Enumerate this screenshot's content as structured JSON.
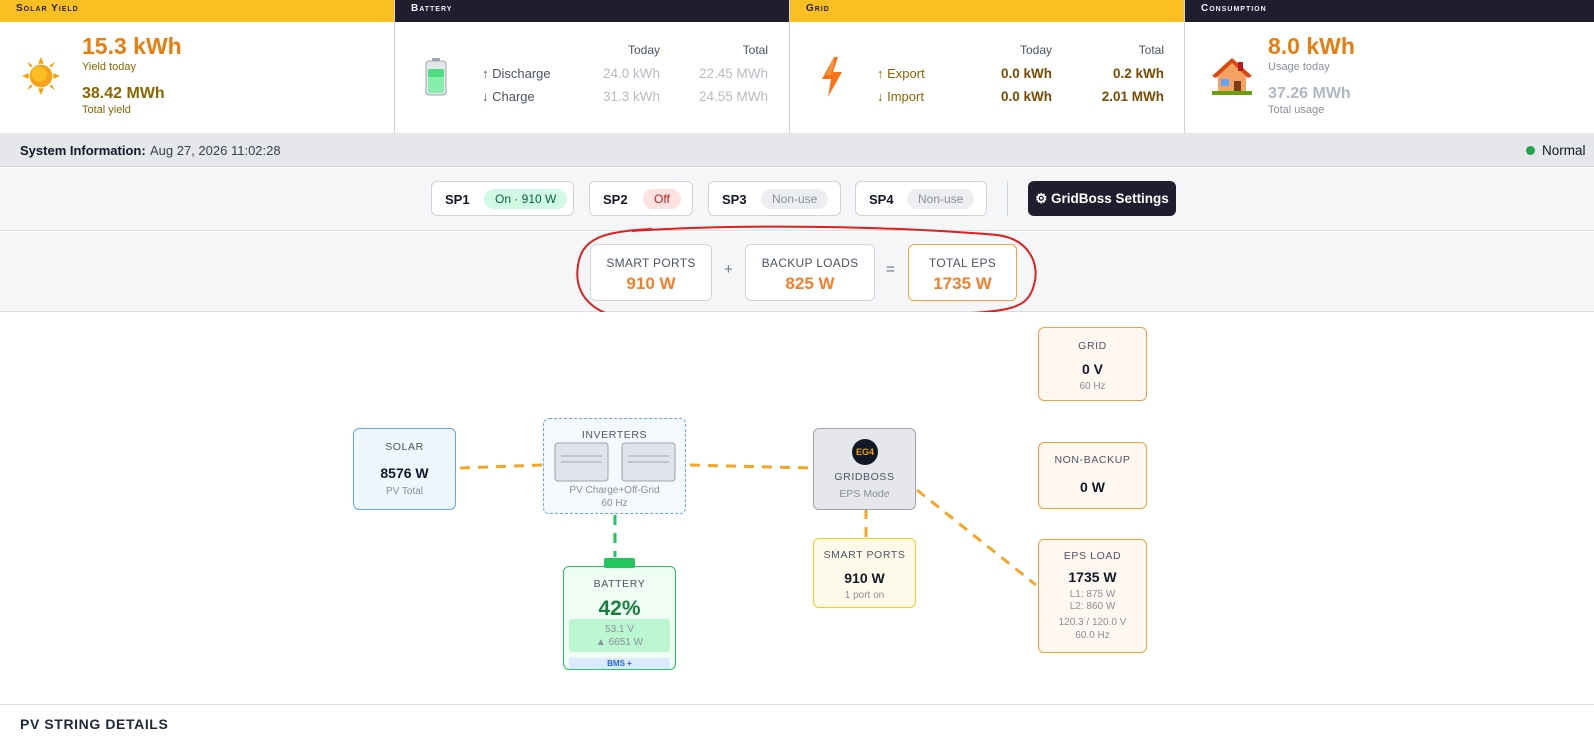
{
  "solar_card": {
    "header": "Solar Yield",
    "today_value": "15.3 kWh",
    "today_label": "Yield today",
    "total_value": "38.42 MWh",
    "total_label": "Total yield"
  },
  "battery_card": {
    "header": "Battery",
    "col_today": "Today",
    "col_total": "Total",
    "rows": [
      {
        "label": "↑ Discharge",
        "today": "24.0 kWh",
        "total": "22.45 MWh"
      },
      {
        "label": "↓ Charge",
        "today": "31.3 kWh",
        "total": "24.55 MWh"
      }
    ]
  },
  "grid_card": {
    "header": "Grid",
    "col_today": "Today",
    "col_total": "Total",
    "rows": [
      {
        "label": "↑ Export",
        "today": "0.0 kWh",
        "total": "0.2 kWh"
      },
      {
        "label": "↓ Import",
        "today": "0.0 kWh",
        "total": "2.01 MWh"
      }
    ]
  },
  "consumption_card": {
    "header": "Consumption",
    "today_value": "8.0 kWh",
    "today_label": "Usage today",
    "total_value": "37.26 MWh",
    "total_label": "Total usage"
  },
  "system_info": {
    "label": "System Information:",
    "timestamp": "Aug 27, 2026 11:02:28",
    "status": "Normal",
    "status_color": "#22a34a"
  },
  "smart_ports": [
    {
      "name": "SP1",
      "state": "On · 910 W"
    },
    {
      "name": "SP2",
      "state": "Off"
    },
    {
      "name": "SP3",
      "state": "Non-use"
    },
    {
      "name": "SP4",
      "state": "Non-use"
    }
  ],
  "gridboss_button": "⚙ GridBoss Settings",
  "eps_summary": {
    "smart_ports_label": "SMART PORTS",
    "smart_ports_value": "910 W",
    "plus": "+",
    "backup_label": "BACKUP LOADS",
    "backup_value": "825 W",
    "equals": "=",
    "total_label": "TOTAL EPS",
    "total_value": "1735 W"
  },
  "diagram": {
    "solar": {
      "title": "SOLAR",
      "value": "8576 W",
      "sub": "PV Total"
    },
    "inverters": {
      "title": "INVERTERS",
      "sub1": "PV Charge+Off-Grid",
      "sub2": "60 Hz"
    },
    "battery": {
      "title": "BATTERY",
      "soc": "42%",
      "voltage": "53.1 V",
      "power": "▲ 6651 W",
      "bms": "BMS +",
      "soc_fraction": 0.42
    },
    "gridboss": {
      "badge": "EG4",
      "title": "GRIDBOSS",
      "sub": "EPS Mode"
    },
    "smart_ports": {
      "title": "SMART PORTS",
      "value": "910 W",
      "sub": "1 port on"
    },
    "grid": {
      "title": "GRID",
      "value": "0 V",
      "sub": "60 Hz"
    },
    "non_backup": {
      "title": "NON-BACKUP",
      "value": "0 W"
    },
    "eps_load": {
      "title": "EPS LOAD",
      "value": "1735 W",
      "l1": "L1: 875 W",
      "l2": "L2: 860 W",
      "volts": "120.3 / 120.0 V",
      "hz": "60.0 Hz"
    }
  },
  "pv_string_title": "PV STRING DETAILS",
  "colors": {
    "accent_orange": "#f47f2a",
    "header_yellow": "#fbbf24",
    "header_dark": "#1e1e2e",
    "annotation_red": "#e11d1d"
  }
}
